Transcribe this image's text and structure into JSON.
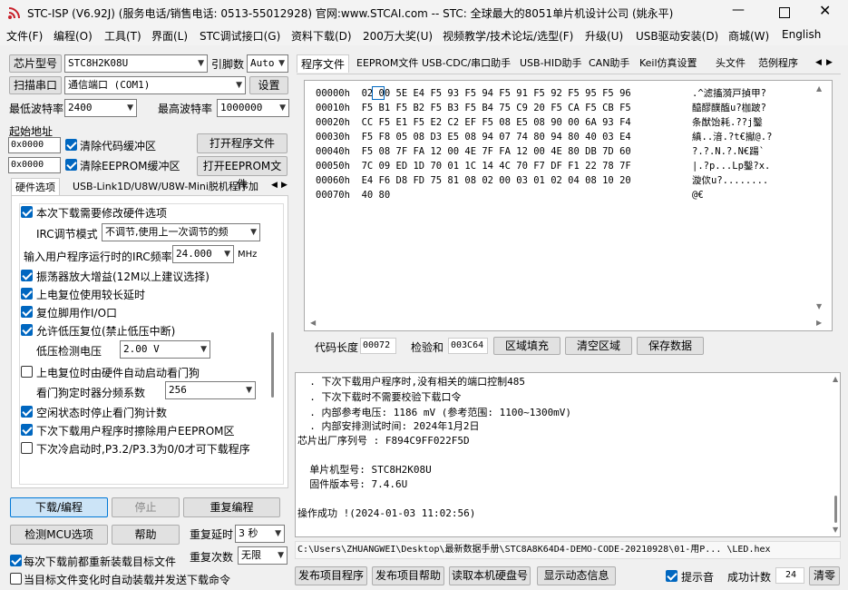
{
  "title": "STC-ISP (V6.92J) (服务电话/销售电话: 0513-55012928) 官网:www.STCAI.com  -- STC: 全球最大的8051单片机设计公司 (姚永平)",
  "menu": [
    "文件(F)",
    "编程(O)",
    "工具(T)",
    "界面(L)",
    "STC调试接口(G)",
    "资料下载(D)",
    "200万大奖(U)",
    "视频教学/技术论坛/选型(F)",
    "升级(U)",
    "USB驱动安装(D)",
    "商城(W)",
    "English"
  ],
  "left": {
    "chip_label": "芯片型号",
    "chip_value": "STC8H2K08U",
    "pin_label": "引脚数",
    "pin_value": "Auto",
    "scan_button": "扫描串口",
    "port_value": "通信端口 (COM1)",
    "settings_button": "设置",
    "min_baud_label": "最低波特率",
    "min_baud_value": "2400",
    "max_baud_label": "最高波特率",
    "max_baud_value": "1000000",
    "start_addr_label": "起始地址",
    "addr1": "0x0000",
    "clear_code_label": "清除代码缓冲区",
    "open_prog_button": "打开程序文件",
    "addr2": "0x0000",
    "clear_eeprom_label": "清除EEPROM缓冲区",
    "open_eeprom_button": "打开EEPROM文件"
  },
  "hw_tabs": [
    "硬件选项",
    "USB-Link1D/U8W/U8W-Mini脱机",
    "程序加"
  ],
  "hw": {
    "opt_modify": "本次下载需要修改硬件选项",
    "irc_mode_label": "IRC调节模式",
    "irc_mode_value": "不调节,使用上一次调节的频",
    "irc_freq_label": "输入用户程序运行时的IRC频率",
    "irc_freq_value": "24.000",
    "irc_freq_unit": "MHz",
    "osc_gain": "振荡器放大增益(12M以上建议选择)",
    "power_delay": "上电复位使用较长延时",
    "reset_io": "复位脚用作I/O口",
    "low_volt_reset": "允许低压复位(禁止低压中断)",
    "low_volt_label": "低压检测电压",
    "low_volt_value": "2.00 V",
    "wdt_auto": "上电复位时由硬件自动启动看门狗",
    "wdt_div_label": "看门狗定时器分频系数",
    "wdt_div_value": "256",
    "idle_stop_wdt": "空闲状态时停止看门狗计数",
    "erase_eeprom": "下次下载用户程序时擦除用户EEPROM区",
    "p32_p33": "下次冷启动时,P3.2/P3.3为0/0才可下载程序"
  },
  "bottom_left": {
    "download_button": "下载/编程",
    "stop_button": "停止",
    "repeat_button": "重复编程",
    "detect_button": "检测MCU选项",
    "help_button": "帮助",
    "repeat_delay_label": "重复延时",
    "repeat_delay_value": "3 秒",
    "repeat_count_label": "重复次数",
    "repeat_count_value": "无限",
    "reload_each": "每次下载前都重新装载目标文件",
    "auto_send": "当目标文件变化时自动装载并发送下载命令"
  },
  "right_tabs": [
    "程序文件",
    "EEPROM文件",
    "USB-CDC/串口助手",
    "USB-HID助手",
    "CAN助手",
    "Keil仿真设置",
    "头文件",
    "范例程序"
  ],
  "hex_rows": [
    {
      "addr": "00000h",
      "bytes": "02 00 5E E4 F5 93 F5 94 F5 91 F5 92 F5 95 F5 96",
      "ascii": ".^滤搐漪戸揁甲?"
    },
    {
      "addr": "00010h",
      "bytes": "F5 B1 F5 B2 F5 B3 F5 B4 75 C9 20 F5 CA F5 CB F5",
      "ascii": "醯醪醭醢u?枷跛?"
    },
    {
      "addr": "00020h",
      "bytes": "CC F5 E1 F5 E2 C2 EF F5 08 E5 08 90 00 6A 93 F4",
      "ascii": "条猷饴耗.??j鑿"
    },
    {
      "addr": "00030h",
      "bytes": "F5 F8 05 08 D3 E5 08 94 07 74 80 94 80 40 03 E4",
      "ascii": "縝..湆.?t€擜@.?"
    },
    {
      "addr": "00040h",
      "bytes": "F5 08 7F FA 12 00 4E 7F FA 12 00 4E 80 DB 7D 60",
      "ascii": "?.?.N.?.N€踼`"
    },
    {
      "addr": "00050h",
      "bytes": "7C 09 ED 1D 70 01 1C 14 4C 70 F7 DF F1 22 78 7F",
      "ascii": "|.?p...Lp鑿?x."
    },
    {
      "addr": "00060h",
      "bytes": "E4 F6 D8 FD 75 81 08 02 00 03 01 02 04 08 10 20",
      "ascii": "漩佽u?........"
    },
    {
      "addr": "00070h",
      "bytes": "40 80",
      "ascii": "@€"
    }
  ],
  "code_len_label": "代码长度",
  "code_len_value": "00072",
  "checksum_label": "检验和",
  "checksum_value": "003C64",
  "fill_button": "区域填充",
  "clear_button": "清空区域",
  "save_button": "保存数据",
  "log_lines": [
    "  . 下次下载用户程序时,没有相关的端口控制485",
    "  . 下次下载时不需要校验下载口令",
    "  . 内部参考电压: 1186 mV (参考范围: 1100~1300mV)",
    "  . 内部安排测试时间: 2024年1月2日",
    "芯片出厂序列号 : F894C9FF022F5D",
    "",
    "  单片机型号: STC8H2K08U",
    "  固件版本号: 7.4.6U",
    "",
    "操作成功 !(2024-01-03 11:02:56)"
  ],
  "file_path": "C:\\Users\\ZHUANGWEI\\Desktop\\最新数据手册\\STC8A8K64D4-DEMO-CODE-20210928\\01-用P... \\LED.hex",
  "bottom_right": {
    "publish_prog": "发布项目程序",
    "publish_help": "发布项目帮助",
    "read_disk": "读取本机硬盘号",
    "show_anim": "显示动态信息",
    "beep_label": "提示音",
    "success_label": "成功计数",
    "success_value": "24",
    "clear_label": "清零"
  },
  "colors": {
    "accent": "#0067c0",
    "title_icon": "#c8202a",
    "log_text": "#00007f"
  }
}
